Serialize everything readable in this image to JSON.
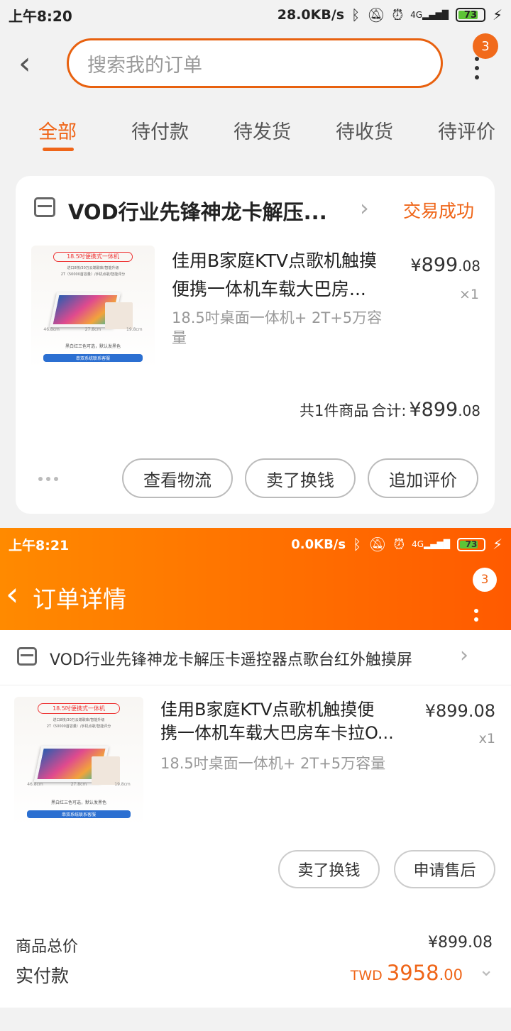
{
  "screen1": {
    "statusbar": {
      "time": "上午8:20",
      "net_speed": "28.0KB/s",
      "signal_label": "4G",
      "battery": "73"
    },
    "search": {
      "placeholder": "搜索我的订单"
    },
    "menu_badge": "3",
    "tabs": [
      {
        "label": "全部",
        "active": true
      },
      {
        "label": "待付款"
      },
      {
        "label": "待发货"
      },
      {
        "label": "待收货"
      },
      {
        "label": "待评价"
      }
    ],
    "order": {
      "shop_name": "VOD行业先锋神龙卡解压...",
      "status": "交易成功",
      "product": {
        "title_line1": "佳用B家庭KTV点歌机触摸",
        "title_line2": "便携一体机车载大巴房...",
        "spec_line1": "18.5吋桌面一体机+ 2T+5万容",
        "spec_line2": "量",
        "price_currency": "¥",
        "price_int": "899",
        "price_dec": ".08",
        "qty": "×1",
        "image_text": {
          "banner": "18.5吋便携式一体机",
          "line1": "进口8核/30万云端歌库/智能升级",
          "line2": "2T（50000首容量）/手机点歌/智能评分",
          "dim_w": "46.8cm",
          "dim_d": "27.8cm",
          "dim_h": "19.8cm",
          "note": "黑白红三色可选，默认发黑色",
          "footer": "串双系统联系客服"
        }
      },
      "total_prefix": "共1件商品",
      "total_label": "合计:",
      "total_currency": "¥",
      "total_int": "899",
      "total_dec": ".08",
      "buttons": [
        "查看物流",
        "卖了换钱",
        "追加评价"
      ]
    }
  },
  "screen2": {
    "statusbar": {
      "time": "上午8:21",
      "net_speed": "0.0KB/s",
      "signal_label": "4G",
      "battery": "73"
    },
    "title": "订单详情",
    "menu_badge": "3",
    "shop_name": "VOD行业先锋神龙卡解压卡遥控器点歌台红外触摸屏",
    "product": {
      "title_line1": "佳用B家庭KTV点歌机触摸便",
      "title_line2": "携一体机车载大巴房车卡拉O...",
      "spec": "18.5吋桌面一体机+ 2T+5万容量",
      "price": "¥899.08",
      "qty": "x1"
    },
    "buttons": [
      "卖了换钱",
      "申请售后"
    ],
    "summary": {
      "goods_total_label": "商品总价",
      "goods_total_value": "¥899.08",
      "paid_label": "实付款",
      "paid_currency": "TWD",
      "paid_int": "3958",
      "paid_dec": ".00"
    }
  },
  "colors": {
    "accent": "#ef6518",
    "header_gradient_start": "#ff8a00",
    "header_gradient_end": "#ff5a00",
    "battery_green": "#5dc437"
  },
  "icons": [
    "back-arrow-icon",
    "more-vertical-icon",
    "shop-icon",
    "chevron-right-icon",
    "chevron-down-icon",
    "bluetooth-icon",
    "alarm-off-icon",
    "clock-icon",
    "signal-icon",
    "charging-icon"
  ]
}
